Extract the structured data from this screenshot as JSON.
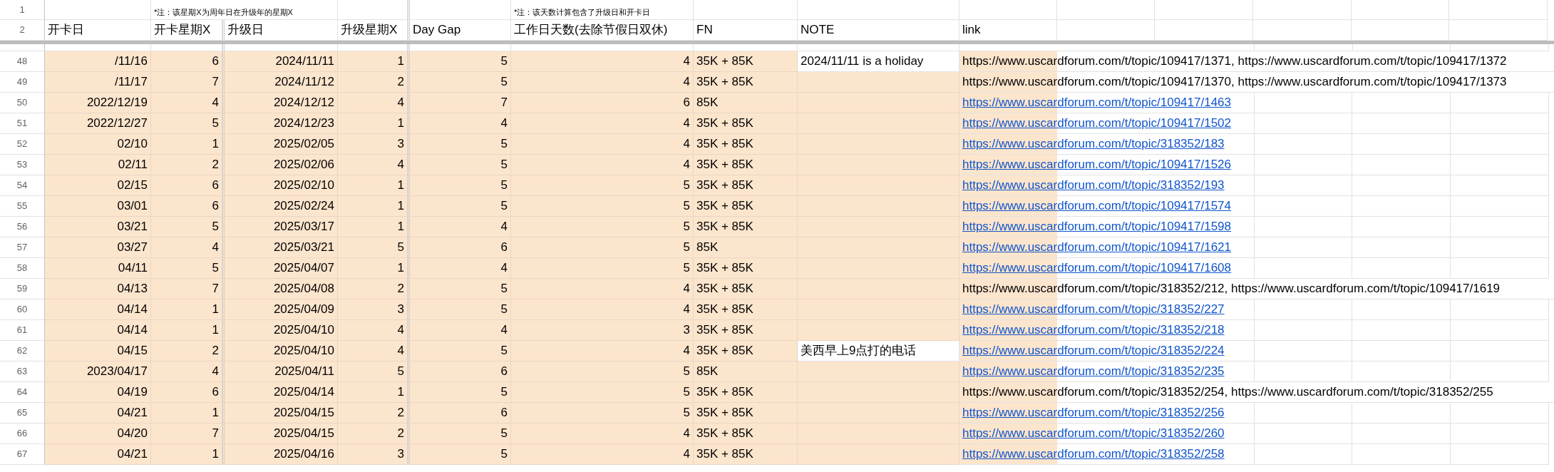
{
  "header_row_numbers": [
    "1",
    "2"
  ],
  "columns": [
    {
      "label": "开卡日"
    },
    {
      "label": "开卡星期X",
      "note": "*注：该星期X为周年日在升级年的星期X"
    },
    {
      "label": "升级日"
    },
    {
      "label": "升级星期X"
    },
    {
      "label": "Day Gap"
    },
    {
      "label": "工作日天数(去除节假日双休)",
      "note": "*注：该天数计算包含了升级日和开卡日"
    },
    {
      "label": "FN"
    },
    {
      "label": "NOTE"
    },
    {
      "label": "link"
    }
  ],
  "rows": [
    {
      "number": "48",
      "cells": [
        "/11/16",
        "6",
        "2024/11/11",
        "1",
        "5",
        "4",
        "35K + 85K"
      ],
      "note": "2024/11/11 is a holiday",
      "link": "https://www.uscardforum.com/t/topic/109417/1371, https://www.uscardforum.com/t/topic/109417/1372",
      "hyperlink": false
    },
    {
      "number": "49",
      "cells": [
        "/11/17",
        "7",
        "2024/11/12",
        "2",
        "5",
        "4",
        "35K + 85K"
      ],
      "link": "https://www.uscardforum.com/t/topic/109417/1370, https://www.uscardforum.com/t/topic/109417/1373",
      "hyperlink": false
    },
    {
      "number": "50",
      "cells": [
        "2022/12/19",
        "4",
        "2024/12/12",
        "4",
        "7",
        "6",
        "85K"
      ],
      "link": "https://www.uscardforum.com/t/topic/109417/1463",
      "hyperlink": true
    },
    {
      "number": "51",
      "cells": [
        "2022/12/27",
        "5",
        "2024/12/23",
        "1",
        "4",
        "4",
        "35K + 85K"
      ],
      "link": "https://www.uscardforum.com/t/topic/109417/1502",
      "hyperlink": true
    },
    {
      "number": "52",
      "cells": [
        "02/10",
        "1",
        "2025/02/05",
        "3",
        "5",
        "4",
        "35K + 85K"
      ],
      "link": "https://www.uscardforum.com/t/topic/318352/183",
      "hyperlink": true
    },
    {
      "number": "53",
      "cells": [
        "02/11",
        "2",
        "2025/02/06",
        "4",
        "5",
        "4",
        "35K + 85K"
      ],
      "link": "https://www.uscardforum.com/t/topic/109417/1526",
      "hyperlink": true
    },
    {
      "number": "54",
      "cells": [
        "02/15",
        "6",
        "2025/02/10",
        "1",
        "5",
        "5",
        "35K + 85K"
      ],
      "link": "https://www.uscardforum.com/t/topic/318352/193",
      "hyperlink": true
    },
    {
      "number": "55",
      "cells": [
        "03/01",
        "6",
        "2025/02/24",
        "1",
        "5",
        "5",
        "35K + 85K"
      ],
      "link": "https://www.uscardforum.com/t/topic/109417/1574",
      "hyperlink": true
    },
    {
      "number": "56",
      "cells": [
        "03/21",
        "5",
        "2025/03/17",
        "1",
        "4",
        "5",
        "35K + 85K"
      ],
      "link": "https://www.uscardforum.com/t/topic/109417/1598",
      "hyperlink": true
    },
    {
      "number": "57",
      "cells": [
        "03/27",
        "4",
        "2025/03/21",
        "5",
        "6",
        "5",
        "85K"
      ],
      "link": "https://www.uscardforum.com/t/topic/109417/1621",
      "hyperlink": true
    },
    {
      "number": "58",
      "cells": [
        "04/11",
        "5",
        "2025/04/07",
        "1",
        "4",
        "5",
        "35K + 85K"
      ],
      "link": "https://www.uscardforum.com/t/topic/109417/1608",
      "hyperlink": true
    },
    {
      "number": "59",
      "cells": [
        "04/13",
        "7",
        "2025/04/08",
        "2",
        "5",
        "4",
        "35K + 85K"
      ],
      "link": "https://www.uscardforum.com/t/topic/318352/212, https://www.uscardforum.com/t/topic/109417/1619",
      "hyperlink": false
    },
    {
      "number": "60",
      "cells": [
        "04/14",
        "1",
        "2025/04/09",
        "3",
        "5",
        "4",
        "35K + 85K"
      ],
      "link": "https://www.uscardforum.com/t/topic/318352/227",
      "hyperlink": true
    },
    {
      "number": "61",
      "cells": [
        "04/14",
        "1",
        "2025/04/10",
        "4",
        "4",
        "3",
        "35K + 85K"
      ],
      "link": "https://www.uscardforum.com/t/topic/318352/218",
      "hyperlink": true
    },
    {
      "number": "62",
      "cells": [
        "04/15",
        "2",
        "2025/04/10",
        "4",
        "5",
        "4",
        "35K + 85K"
      ],
      "note": "美西早上9点打的电话",
      "link": "https://www.uscardforum.com/t/topic/318352/224",
      "hyperlink": true
    },
    {
      "number": "63",
      "cells": [
        "2023/04/17",
        "4",
        "2025/04/11",
        "5",
        "6",
        "5",
        "85K"
      ],
      "link": "https://www.uscardforum.com/t/topic/318352/235",
      "hyperlink": true
    },
    {
      "number": "64",
      "cells": [
        "04/19",
        "6",
        "2025/04/14",
        "1",
        "5",
        "5",
        "35K + 85K"
      ],
      "link": "https://www.uscardforum.com/t/topic/318352/254, https://www.uscardforum.com/t/topic/318352/255",
      "hyperlink": false
    },
    {
      "number": "65",
      "cells": [
        "04/21",
        "1",
        "2025/04/15",
        "2",
        "6",
        "5",
        "35K + 85K"
      ],
      "link": "https://www.uscardforum.com/t/topic/318352/256",
      "hyperlink": true
    },
    {
      "number": "66",
      "cells": [
        "04/20",
        "7",
        "2025/04/15",
        "2",
        "5",
        "4",
        "35K + 85K"
      ],
      "link": "https://www.uscardforum.com/t/topic/318352/260",
      "hyperlink": true
    },
    {
      "number": "67",
      "cells": [
        "04/21",
        "1",
        "2025/04/16",
        "3",
        "5",
        "4",
        "35K + 85K"
      ],
      "link": "https://www.uscardforum.com/t/topic/318352/258",
      "hyperlink": true
    }
  ]
}
